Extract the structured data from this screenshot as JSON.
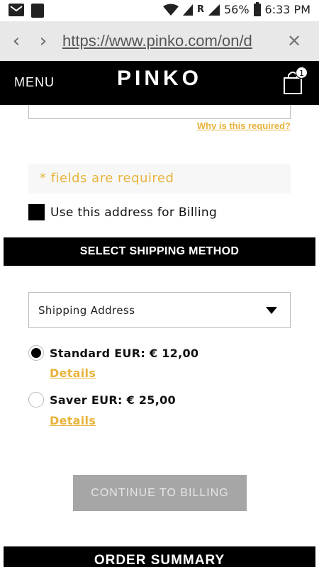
{
  "status_bar": {
    "battery": "56%",
    "time": "6:33 PM",
    "network_label": "R"
  },
  "browser": {
    "url": "https://www.pinko.com/on/d"
  },
  "site_header": {
    "menu_label": "MENU",
    "logo": "PINKO",
    "cart_count": "1"
  },
  "address_form": {
    "why_required_link": "Why is this required?",
    "required_note": "* fields are required",
    "billing_checkbox_label": "Use this address for Billing"
  },
  "shipping": {
    "section_title": "SELECT SHIPPING METHOD",
    "address_select_value": "Shipping Address",
    "methods": [
      {
        "label": "Standard EUR: € 12,00",
        "details": "Details",
        "selected": true
      },
      {
        "label": "Saver EUR: € 25,00",
        "details": "Details",
        "selected": false
      }
    ],
    "continue_label": "CONTINUE TO BILLING"
  },
  "order_summary": {
    "title": "ORDER SUMMARY"
  },
  "colors": {
    "accent": "#e8b33c",
    "header_bg": "#000000",
    "button_disabled": "#a6a6a6"
  }
}
